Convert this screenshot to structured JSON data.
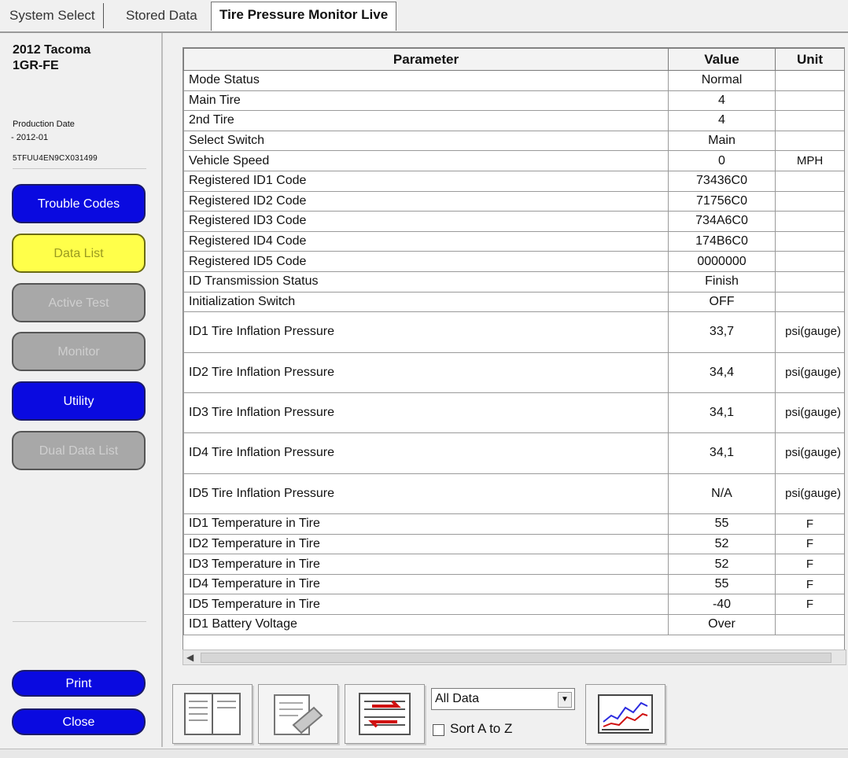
{
  "tabs": [
    {
      "label": "System Select"
    },
    {
      "label": "Stored Data"
    },
    {
      "label": "Tire Pressure Monitor Live"
    }
  ],
  "vehicle": {
    "model": "2012 Tacoma\n1GR-FE",
    "production_label": "Production Date",
    "production_date": "- 2012-01",
    "vin": "5TFUU4EN9CX031499"
  },
  "sidebar_buttons": {
    "trouble_codes": "Trouble Codes",
    "data_list": "Data List",
    "active_test": "Active Test",
    "monitor": "Monitor",
    "utility": "Utility",
    "dual_data_list": "Dual Data List",
    "print": "Print",
    "close": "Close"
  },
  "colors": {
    "blue_button": "#0a0ae0",
    "yellow_button": "#ffff4a",
    "disabled_button": "#a8a8a8"
  },
  "table": {
    "headers": [
      "Parameter",
      "Value",
      "Unit"
    ],
    "rows": [
      {
        "parameter": "Mode Status",
        "value": "Normal",
        "unit": ""
      },
      {
        "parameter": "Main Tire",
        "value": "4",
        "unit": ""
      },
      {
        "parameter": "2nd Tire",
        "value": "4",
        "unit": ""
      },
      {
        "parameter": "Select Switch",
        "value": "Main",
        "unit": ""
      },
      {
        "parameter": "Vehicle Speed",
        "value": "0",
        "unit": "MPH"
      },
      {
        "parameter": "Registered ID1 Code",
        "value": "73436C0",
        "unit": ""
      },
      {
        "parameter": "Registered ID2 Code",
        "value": "71756C0",
        "unit": ""
      },
      {
        "parameter": "Registered ID3 Code",
        "value": "734A6C0",
        "unit": ""
      },
      {
        "parameter": "Registered ID4 Code",
        "value": "174B6C0",
        "unit": ""
      },
      {
        "parameter": "Registered ID5 Code",
        "value": "0000000",
        "unit": ""
      },
      {
        "parameter": "ID Transmission Status",
        "value": "Finish",
        "unit": ""
      },
      {
        "parameter": "Initialization Switch",
        "value": "OFF",
        "unit": ""
      },
      {
        "parameter": "ID1 Tire Inflation Pressure",
        "value": "33,7",
        "unit": "psi(gauge)"
      },
      {
        "parameter": "ID2 Tire Inflation Pressure",
        "value": "34,4",
        "unit": "psi(gauge)"
      },
      {
        "parameter": "ID3 Tire Inflation Pressure",
        "value": "34,1",
        "unit": "psi(gauge)"
      },
      {
        "parameter": "ID4 Tire Inflation Pressure",
        "value": "34,1",
        "unit": "psi(gauge)"
      },
      {
        "parameter": "ID5 Tire Inflation Pressure",
        "value": "N/A",
        "unit": "psi(gauge)"
      },
      {
        "parameter": "ID1 Temperature in Tire",
        "value": "55",
        "unit": "F"
      },
      {
        "parameter": "ID2 Temperature in Tire",
        "value": "52",
        "unit": "F"
      },
      {
        "parameter": "ID3 Temperature in Tire",
        "value": "52",
        "unit": "F"
      },
      {
        "parameter": "ID4 Temperature in Tire",
        "value": "55",
        "unit": "F"
      },
      {
        "parameter": "ID5 Temperature in Tire",
        "value": "-40",
        "unit": "F"
      },
      {
        "parameter": "ID1 Battery Voltage",
        "value": "Over",
        "unit": ""
      }
    ]
  },
  "toolbar": {
    "filter_select": "All Data",
    "sort_label": "Sort A to Z",
    "sort_checked": false,
    "icons": [
      "display-select-icon",
      "snapshot-icon",
      "record-icon",
      "graph-icon"
    ]
  }
}
